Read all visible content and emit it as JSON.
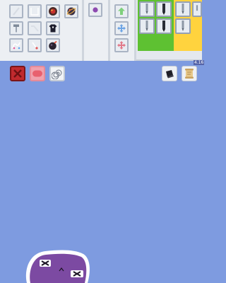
{
  "app": {
    "background_color": "#7e9be0",
    "toolbar_color": "#e4e8ee",
    "version_badge": "4.16"
  },
  "toolbar": {
    "tools": [
      {
        "icon": "wand-icon"
      },
      {
        "icon": "frame-icon"
      },
      {
        "icon": "red-orb-icon"
      },
      {
        "icon": "planet-icon"
      },
      {
        "icon": "paint-roller-icon"
      },
      {
        "icon": "wrench-icon"
      },
      {
        "icon": "shirt-icon"
      },
      {
        "icon": "stretch-icon"
      },
      {
        "icon": "brush-icon"
      },
      {
        "icon": "bomb-icon"
      }
    ],
    "selected_color_icon": "purple-dot-icon",
    "move_controls": [
      {
        "icon": "move-up-icon"
      },
      {
        "icon": "move-center-icon"
      },
      {
        "icon": "move-down-icon"
      }
    ],
    "green_palette": {
      "color": "#5ec132",
      "items": [
        "pen-icon",
        "dark-pen-icon",
        "pen-icon",
        "dark-pen-icon"
      ]
    },
    "yellow_palette": {
      "color": "#ffd33e",
      "items": [
        "pen-icon",
        "pen-icon",
        "pen-icon"
      ]
    }
  },
  "canvas_controls": {
    "close_color": "#c02a2e",
    "eraser_color": "#f0a1ad",
    "left_buttons": [
      "close-icon",
      "eraser-icon",
      "spiral-icon"
    ],
    "right_buttons": [
      "hat-icon",
      "scroll-icon"
    ]
  },
  "creature": {
    "body_color": "#7c4aa2",
    "outline_color": "#ffffff"
  }
}
